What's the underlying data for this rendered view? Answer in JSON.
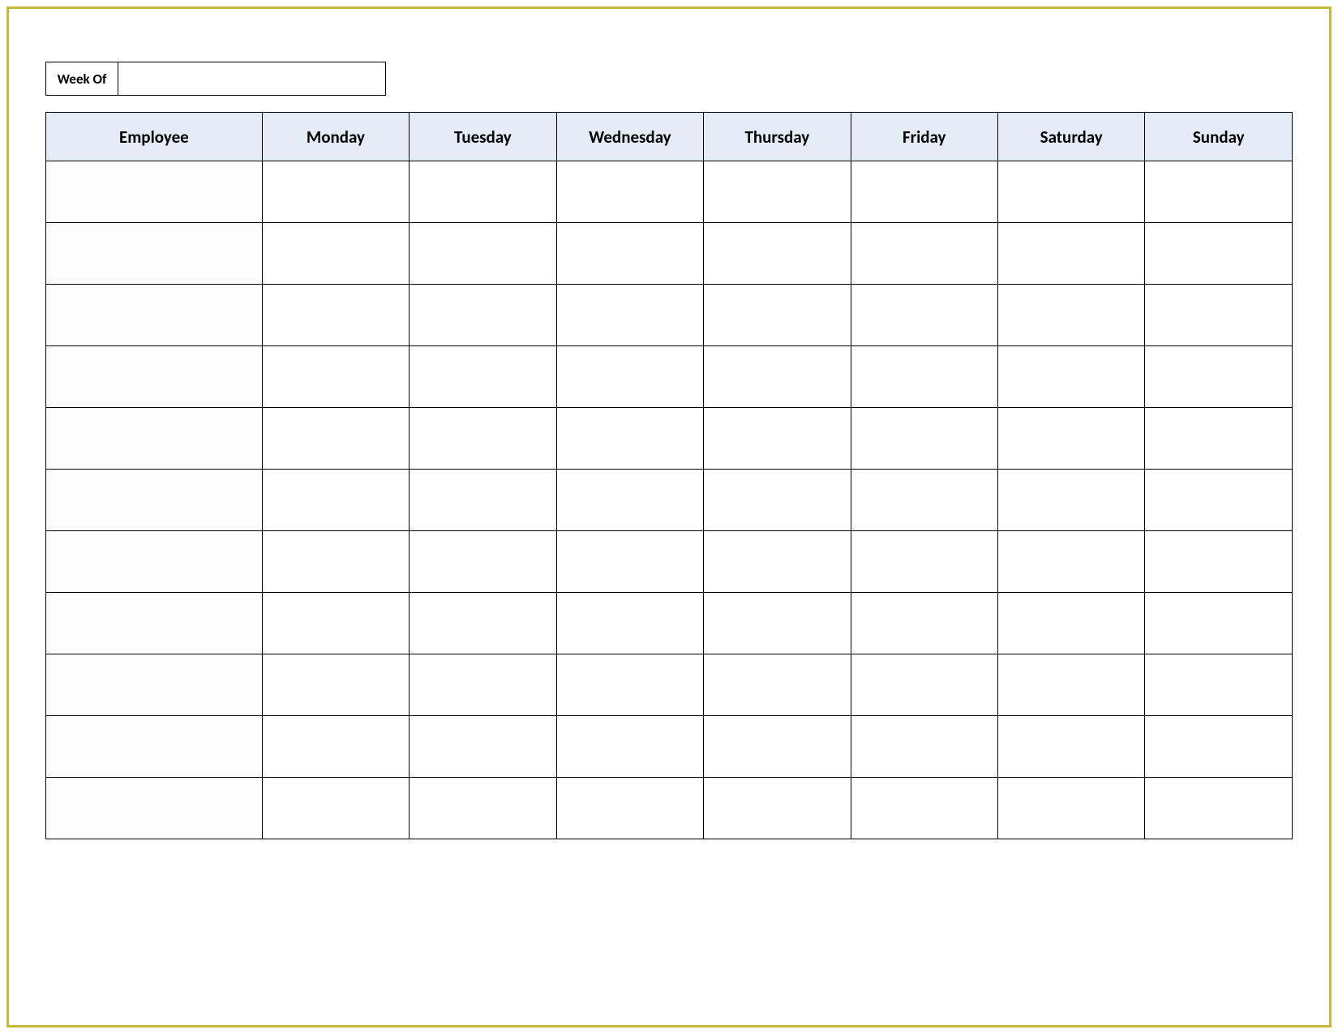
{
  "week_of_label": "Week Of",
  "week_of_value": "",
  "table": {
    "headers": [
      "Employee",
      "Monday",
      "Tuesday",
      "Wednesday",
      "Thursday",
      "Friday",
      "Saturday",
      "Sunday"
    ],
    "num_rows": 11
  }
}
